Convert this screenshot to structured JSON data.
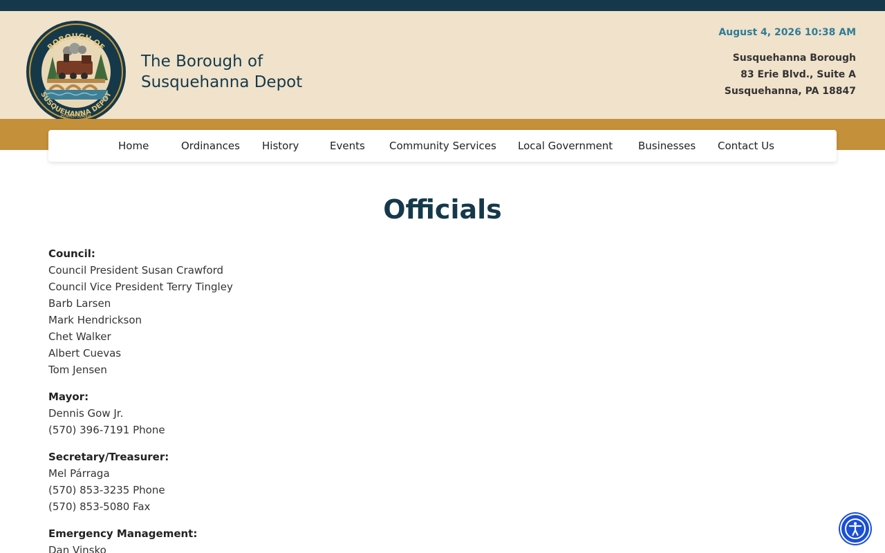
{
  "site": {
    "title_line1": "The Borough of",
    "title_line2": "Susquehanna Depot",
    "seal_text_top": "BOROUGH OF",
    "seal_text_bottom": "SUSQUEHANNA DEPOT",
    "seal_text_state": "PENNSYLVANIA"
  },
  "header": {
    "datetime": "August 4, 2026 10:38 AM",
    "address": {
      "name": "Susquehanna Borough",
      "street": "83 Erie Blvd., Suite A",
      "city": "Susquehanna, PA 18847"
    }
  },
  "nav": {
    "items": [
      {
        "label": "Home"
      },
      {
        "label": "Ordinances"
      },
      {
        "label": "History"
      },
      {
        "label": "Events"
      },
      {
        "label": "Community Services"
      },
      {
        "label": "Local Government"
      },
      {
        "label": "Businesses"
      },
      {
        "label": "Contact Us"
      }
    ]
  },
  "page": {
    "title": "Officials"
  },
  "sections": {
    "council": {
      "title": "Council:",
      "lines": [
        "Council President Susan Crawford",
        "Council Vice President Terry Tingley",
        "Barb Larsen",
        "Mark Hendrickson",
        "Chet Walker",
        "Albert Cuevas",
        "Tom Jensen"
      ]
    },
    "mayor": {
      "title": "Mayor:",
      "lines": [
        "Dennis Gow Jr.",
        "(570) 396-7191 Phone"
      ]
    },
    "secretary": {
      "title": "Secretary/Treasurer:",
      "lines": [
        "Mel Párraga",
        "(570) 853-3235 Phone",
        "(570) 853-5080 Fax"
      ]
    },
    "emergency": {
      "title": "Emergency Management:",
      "lines": [
        "Dan Vinsko"
      ]
    }
  },
  "accessibility": {
    "icon": "accessibility-icon"
  },
  "colors": {
    "topbar": "#15394a",
    "header_bg": "#f0e2cb",
    "gold_band": "#c4903a",
    "accent_blue": "#2e7c97",
    "title_navy": "#15394a",
    "a11y_button": "#1a4fd6"
  }
}
